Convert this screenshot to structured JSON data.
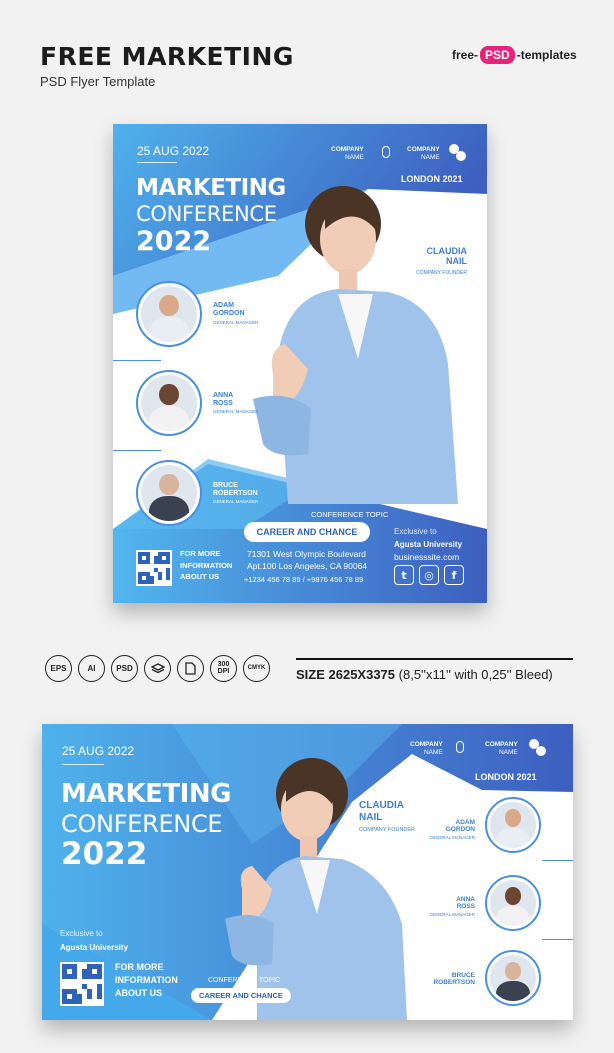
{
  "header": {
    "title": "FREE MARKETING",
    "subtitle": "PSD Flyer Template",
    "logo_left": "free-",
    "logo_mid": "PSD",
    "logo_right": "-templates"
  },
  "flyer": {
    "date": "25 AUG 2022",
    "marketing": "MARKETING",
    "conference": "CONFERENCE",
    "year": "2022",
    "company_label": "COMPANY",
    "company_name": "NAME",
    "city": "LONDON 2021",
    "featured": {
      "name_line1": "CLAUDIA",
      "name_line2": "NAIL",
      "role": "COMPANY FOUNDER"
    },
    "speakers": [
      {
        "line1": "ADAM",
        "line2": "GORDON",
        "role": "GENERAL MANAGER"
      },
      {
        "line1": "ANNA",
        "line2": "ROSS",
        "role": "GENERAL MANAGER"
      },
      {
        "line1": "BRUCE",
        "line2": "ROBERTSON",
        "role": "GENERAL MANAGER"
      }
    ],
    "topic_label": "CONFERENCE TOPIC",
    "topic": "CAREER AND CHANCE",
    "more": [
      "FOR MORE",
      "INFORMATION",
      "ABOUT US"
    ],
    "address_line1": "71301 West Olympic Boulevard",
    "address_line2": "Apt.100 Los Angeles, CA 90064",
    "phones": "+1234 456 78 89 / +9876 456 78 89",
    "exclusive": "Exclusive to",
    "university": "Agusta University",
    "website": "businesssite.com",
    "social": [
      "t",
      "◎",
      "f"
    ]
  },
  "formats": [
    "EPS",
    "AI",
    "PSD",
    "",
    "",
    "300 DPI",
    "CMYK"
  ],
  "size": {
    "bold": "SIZE 2625X3375",
    "rest": " (8,5''x11'' with 0,25'' Bleed)"
  },
  "colors": {
    "blue_dark": "#3d5fc0",
    "blue_light": "#4fb2ec",
    "accent_pink": "#e6227a"
  }
}
